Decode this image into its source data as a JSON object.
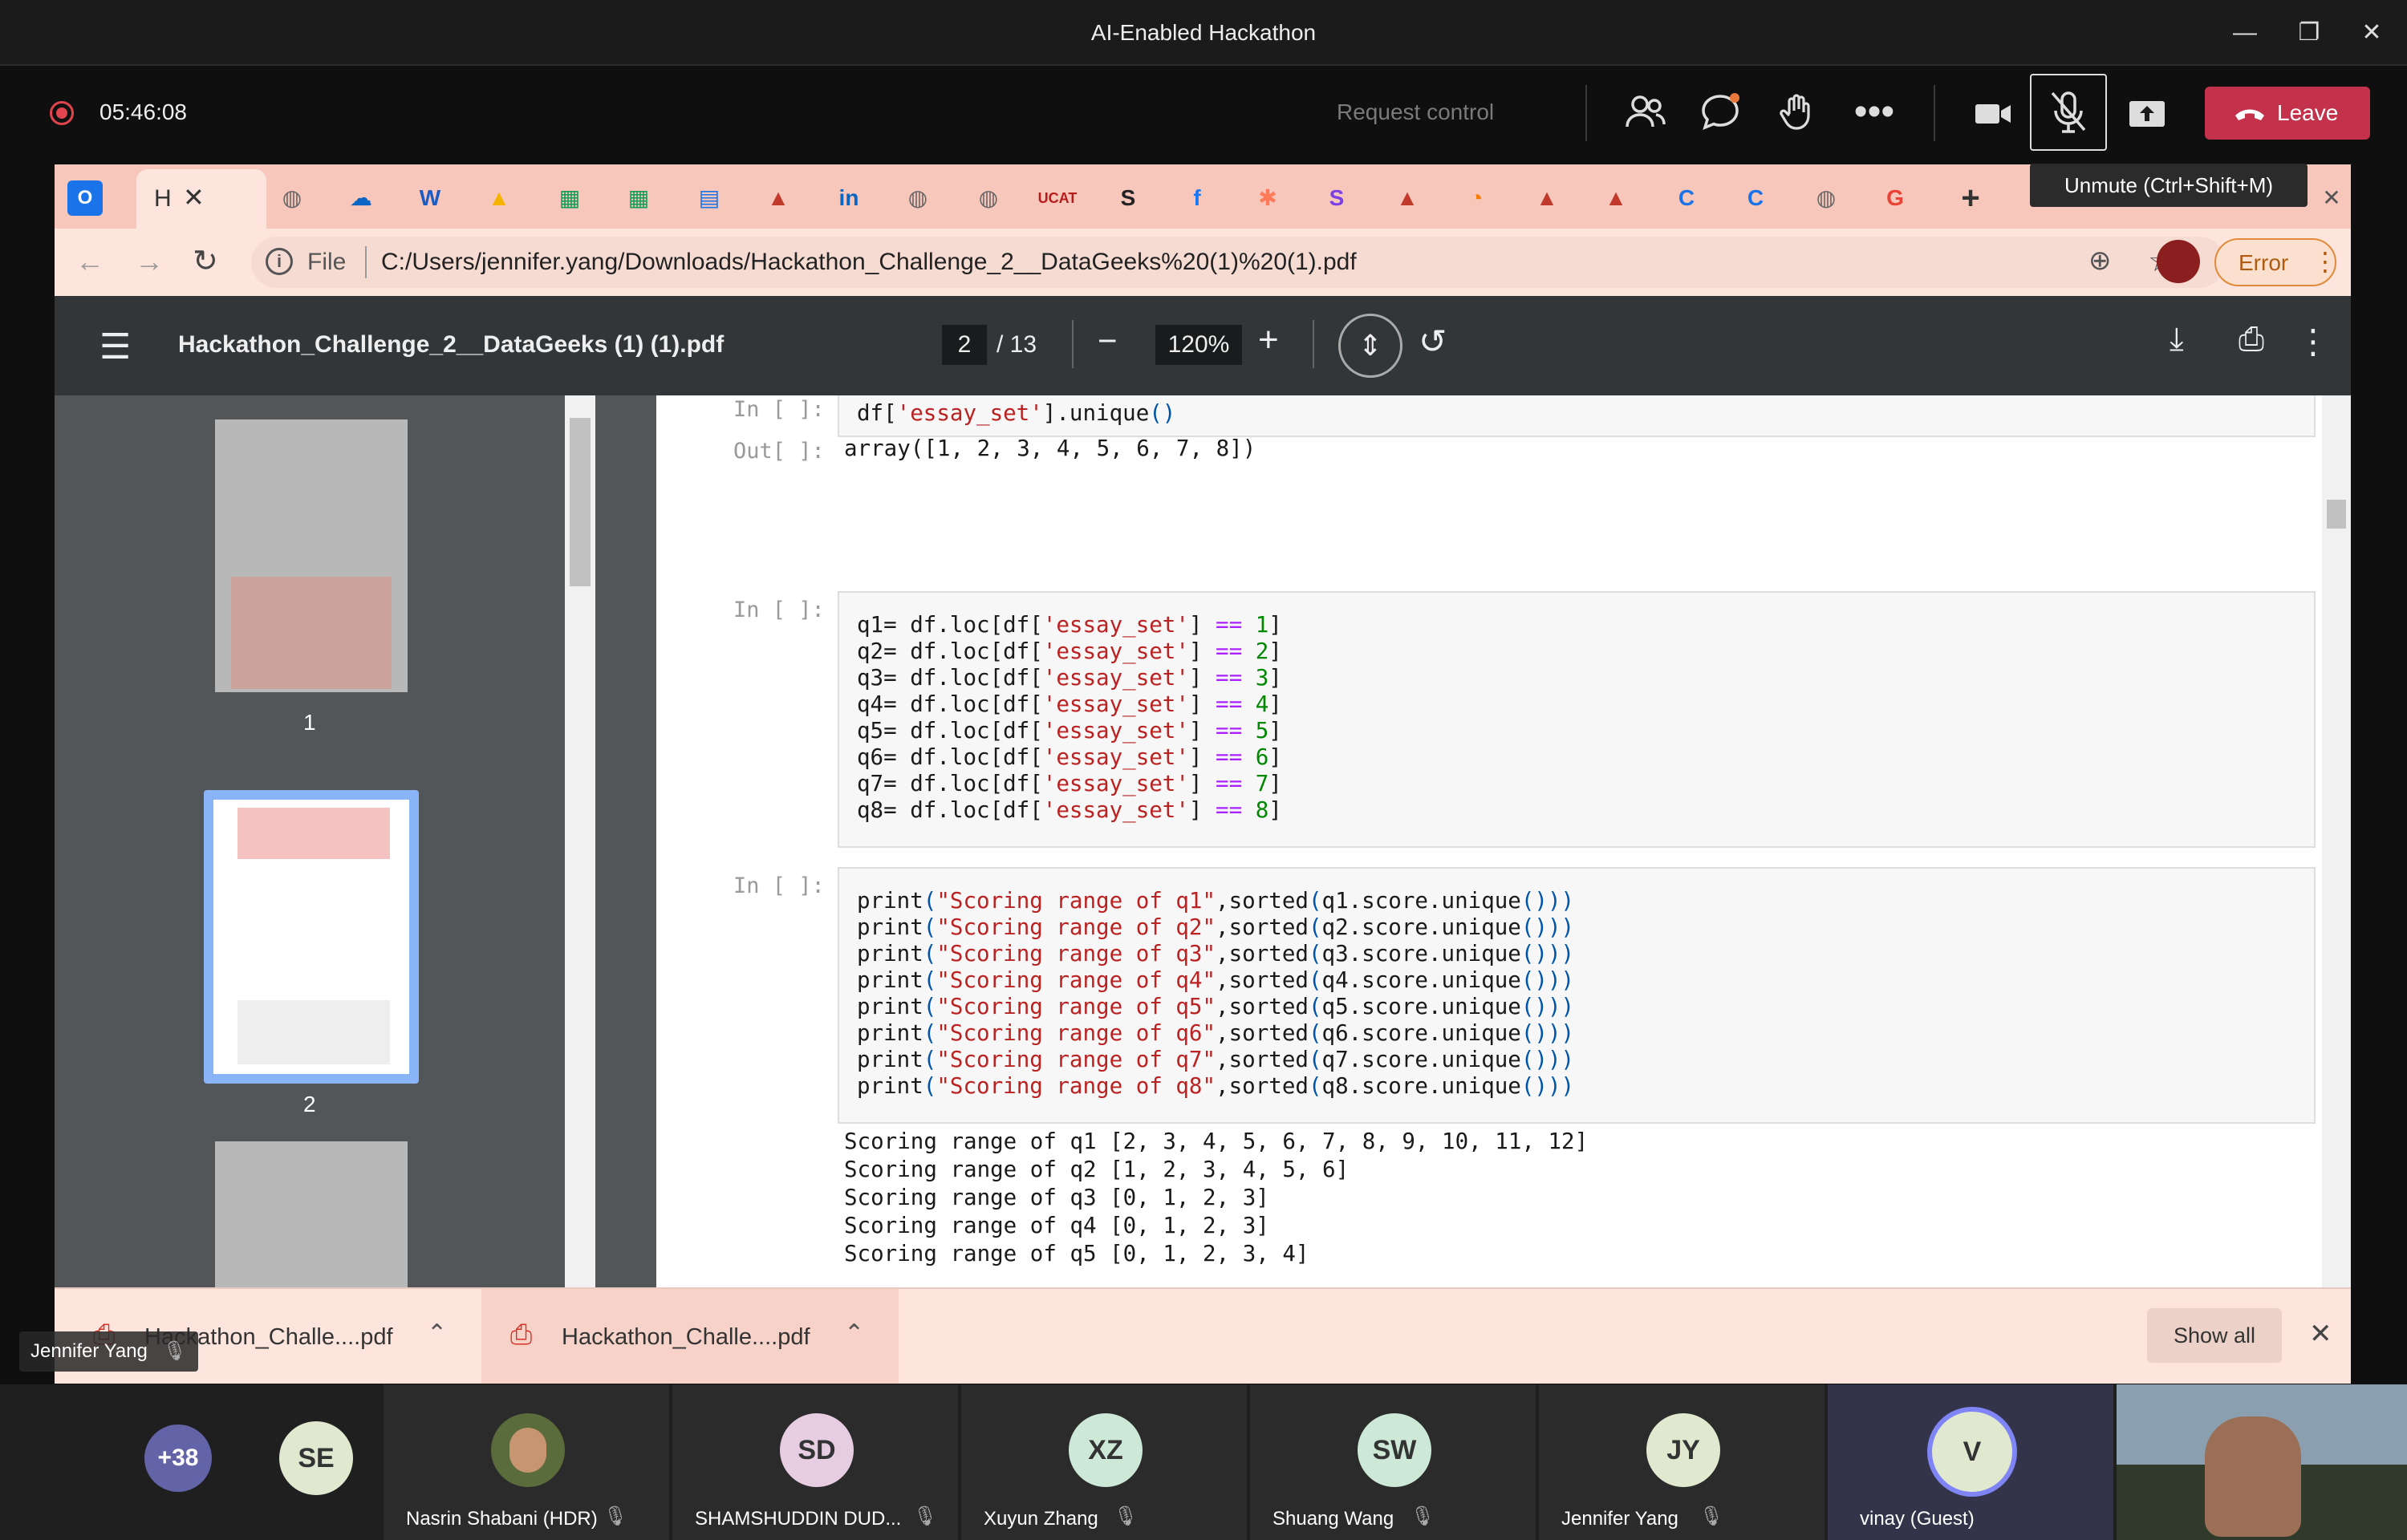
{
  "window": {
    "title": "AI-Enabled Hackathon"
  },
  "meeting": {
    "timer": "05:46:08",
    "request_control": "Request control",
    "leave": "Leave",
    "tooltip": "Unmute (Ctrl+Shift+M)",
    "self_label": "Jennifer Yang"
  },
  "browser": {
    "active_tab_letter": "H",
    "address_prefix": "File",
    "url": "C:/Users/jennifer.yang/Downloads/Hackathon_Challenge_2__DataGeeks%20(1)%20(1).pdf",
    "error_label": "Error"
  },
  "pdf": {
    "filename": "Hackathon_Challenge_2__DataGeeks (1) (1).pdf",
    "current_page": "2",
    "total_pages": "/ 13",
    "zoom": "120%",
    "thumb1_label": "1",
    "thumb2_label": "2"
  },
  "notebook": {
    "in_prompt": "In [ ]:",
    "out_prompt": "Out[ ]:",
    "cell1_out": "array([1, 2, 3, 4, 5, 6, 7, 8])",
    "scoring_output": [
      "Scoring range of q1 [2, 3, 4, 5, 6, 7, 8, 9, 10, 11, 12]",
      "Scoring range of q2 [1, 2, 3, 4, 5, 6]",
      "Scoring range of q3 [0, 1, 2, 3]",
      "Scoring range of q4 [0, 1, 2, 3]",
      "Scoring range of q5 [0, 1, 2, 3, 4]"
    ]
  },
  "downloads": {
    "item1": "Hackathon_Challe....pdf",
    "item2": "Hackathon_Challe....pdf",
    "show_all": "Show all"
  },
  "participants": {
    "overflow": "+38",
    "se": "SE",
    "p1_name": "Nasrin Shabani (HDR)",
    "p2_initials": "SD",
    "p2_name": "SHAMSHUDDIN DUD...",
    "p3_initials": "XZ",
    "p3_name": "Xuyun Zhang",
    "p4_initials": "SW",
    "p4_name": "Shuang Wang",
    "p5_initials": "JY",
    "p5_name": "Jennifer Yang",
    "p6_initials": "V",
    "p6_name": "vinay (Guest)"
  },
  "colors": {
    "leave": "#c4314b",
    "tab_bar": "#f7c7bb",
    "accent_blue": "#8ab4f8"
  }
}
